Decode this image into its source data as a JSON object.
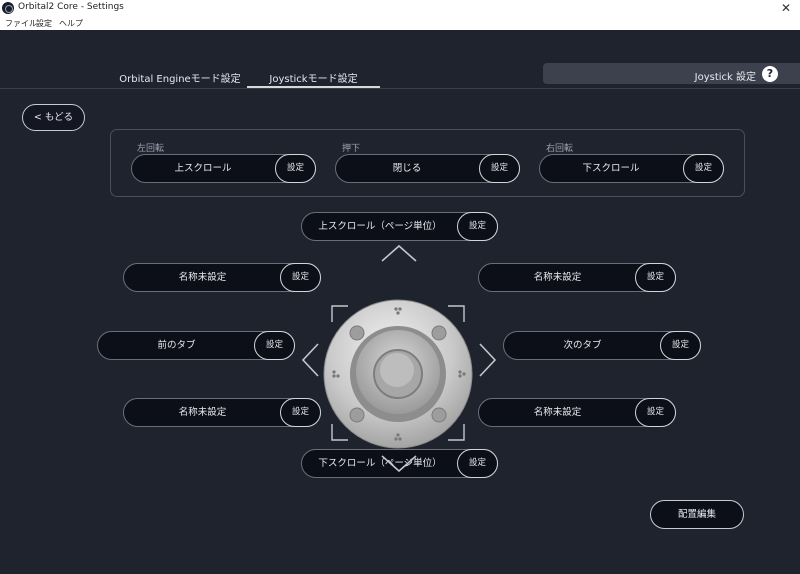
{
  "window": {
    "title": "Orbital2 Core - Settings",
    "close": "✕"
  },
  "menu": [
    "ファイル",
    "設定",
    "ヘルプ"
  ],
  "tabs": [
    {
      "label": "Orbital Engineモード設定",
      "active": false
    },
    {
      "label": "Joystickモード設定",
      "active": true
    }
  ],
  "header": {
    "label": "Joystick 設定",
    "help": "?"
  },
  "back_label": "< もどる",
  "set_label": "設定",
  "rotation": {
    "left": {
      "caption": "左回転",
      "value": "上スクロール"
    },
    "press": {
      "caption": "押下",
      "value": "閉じる"
    },
    "right": {
      "caption": "右回転",
      "value": "下スクロール"
    }
  },
  "directions": {
    "up": "上スクロール（ページ単位）",
    "upper_left": "名称未設定",
    "upper_right": "名称未設定",
    "left": "前のタブ",
    "right": "次のタブ",
    "lower_left": "名称未設定",
    "lower_right": "名称未設定",
    "down": "下スクロール（ページ単位）"
  },
  "layout_edit_label": "配置編集",
  "colors": {
    "background": "#1f232e",
    "pill": "#0c0f18",
    "header": "#3c414d"
  }
}
